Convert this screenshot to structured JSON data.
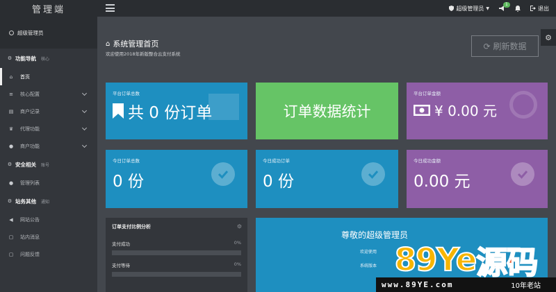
{
  "topbar": {
    "brand": "管理端",
    "admin_label": "超级管理员",
    "notify_count": "1",
    "logout_label": "退出"
  },
  "sidebar": {
    "user": "超级管理员",
    "sections": [
      {
        "title": "功能导航",
        "sub": "核心"
      },
      {
        "title": "安全相关",
        "sub": "账号"
      },
      {
        "title": "站务其他",
        "sub": "通知"
      }
    ],
    "nav1": [
      {
        "label": "首页",
        "icon": "home-icon"
      },
      {
        "label": "核心配置",
        "icon": "sliders-icon"
      },
      {
        "label": "商户记录",
        "icon": "list-icon"
      },
      {
        "label": "代理功能",
        "icon": "crown-icon"
      },
      {
        "label": "商户功能",
        "icon": "user-icon"
      }
    ],
    "nav2": [
      {
        "label": "管理列表",
        "icon": "user-icon"
      }
    ],
    "nav3": [
      {
        "label": "网站公告",
        "icon": "bullhorn-icon"
      },
      {
        "label": "站内消息",
        "icon": "message-icon"
      },
      {
        "label": "问题反馈",
        "icon": "feedback-icon"
      }
    ]
  },
  "header": {
    "title": "系统管理首页",
    "subtitle": "欢迎使用2018年新版整合云支付系统",
    "refresh_label": "刷新数据"
  },
  "cards": {
    "platform_orders": {
      "label": "平台订单总数",
      "value": "共 0 份订单"
    },
    "order_stats": {
      "label": "订单数据统计"
    },
    "platform_amount": {
      "label": "平台订单金额",
      "value": "¥ 0.00 元"
    },
    "today_orders": {
      "label": "今日订单总数",
      "value": "0 份"
    },
    "today_success": {
      "label": "今日成功订单",
      "value": "0 份"
    },
    "today_amount": {
      "label": "今日成功金额",
      "value": "0.00 元"
    }
  },
  "panel": {
    "title": "订单支付比例分析",
    "rows": [
      {
        "label": "支付成功",
        "percent": "0%",
        "fill": 0
      },
      {
        "label": "支付等待",
        "percent": "0%",
        "fill": 0
      }
    ]
  },
  "welcome": {
    "title": "尊敬的超级管理员",
    "line1": "欢迎使用",
    "line2": "系统版本"
  },
  "watermark": {
    "logo_text_1": "89Ye",
    "logo_text_2": "源码",
    "url": "www.89YE.com",
    "slogan": "10年老站"
  },
  "colors": {
    "blue": "#1e8fc0",
    "green": "#66c466",
    "purple": "#8e5ea6",
    "sidebar": "#33363b",
    "content": "#43474d"
  }
}
